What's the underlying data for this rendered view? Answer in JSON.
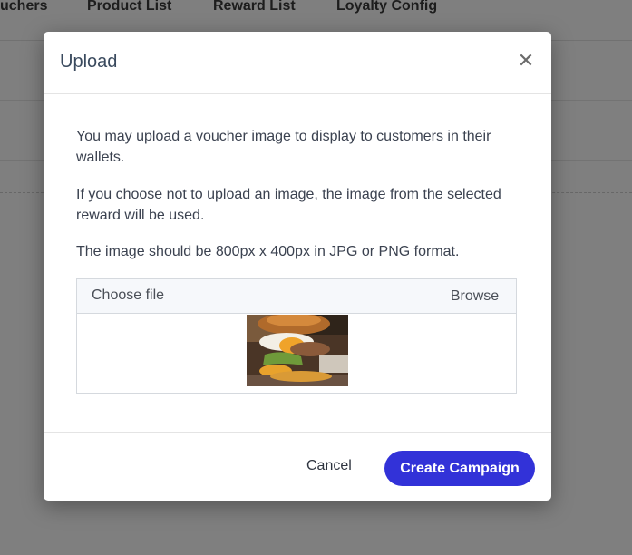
{
  "background_tabs": [
    "uchers",
    "Product List",
    "Reward List",
    "Loyalty Config"
  ],
  "modal": {
    "title": "Upload",
    "close_icon": "close-icon",
    "paragraphs": [
      "You may upload a voucher image to display to customers in their wallets.",
      "If you choose not to upload an image, the image from the selected reward will be used.",
      "The image should be 800px x 400px in JPG or PNG format."
    ],
    "file_input": {
      "placeholder": "Choose file",
      "browse_label": "Browse"
    },
    "preview": {
      "description": "voucher image preview"
    },
    "footer": {
      "cancel_label": "Cancel",
      "create_label": "Create Campaign"
    }
  },
  "colors": {
    "primary_button": "#3232d8",
    "overlay": "rgba(0,0,0,0.5)",
    "title_text": "#3a4a5e"
  }
}
